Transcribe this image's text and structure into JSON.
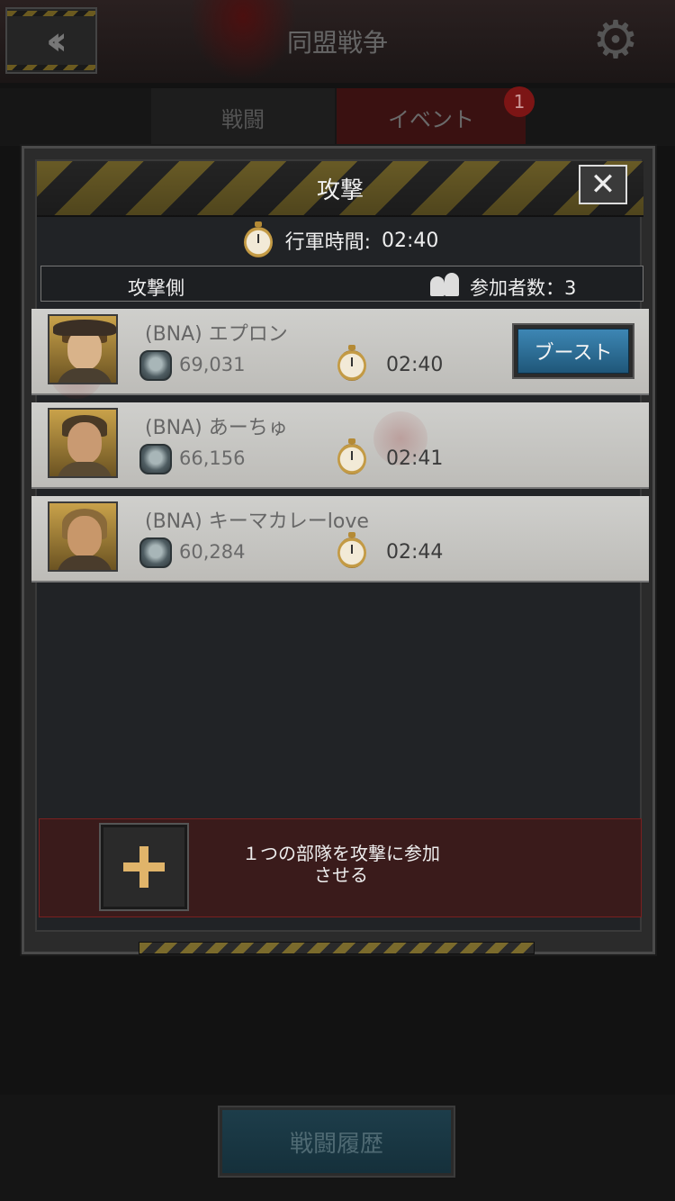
{
  "background": {
    "title": "同盟戦争",
    "tabs": [
      {
        "label": "戦闘"
      },
      {
        "label": "イベント",
        "badge": "1"
      }
    ],
    "history_button": "戦闘履歴"
  },
  "modal": {
    "title": "攻撃",
    "march_label": "行軍時間:",
    "march_time": "02:40",
    "side_label": "攻撃側",
    "participants_label": "参加者数：3",
    "members": [
      {
        "name": "(BNA) エプロン",
        "power": "69,031",
        "time": "02:40",
        "boost": "ブースト"
      },
      {
        "name": "(BNA) あーちゅ",
        "power": "66,156",
        "time": "02:41"
      },
      {
        "name": "(BNA) キーマカレーlove",
        "power": "60,284",
        "time": "02:44"
      }
    ],
    "join_text_line1": "１つの部隊を攻撃に参加",
    "join_text_line2": "させる"
  },
  "colors": {
    "accent_blue": "#2f6f99",
    "hazard_yellow": "#7a6a2c",
    "join_panel": "#3a1b1b"
  }
}
